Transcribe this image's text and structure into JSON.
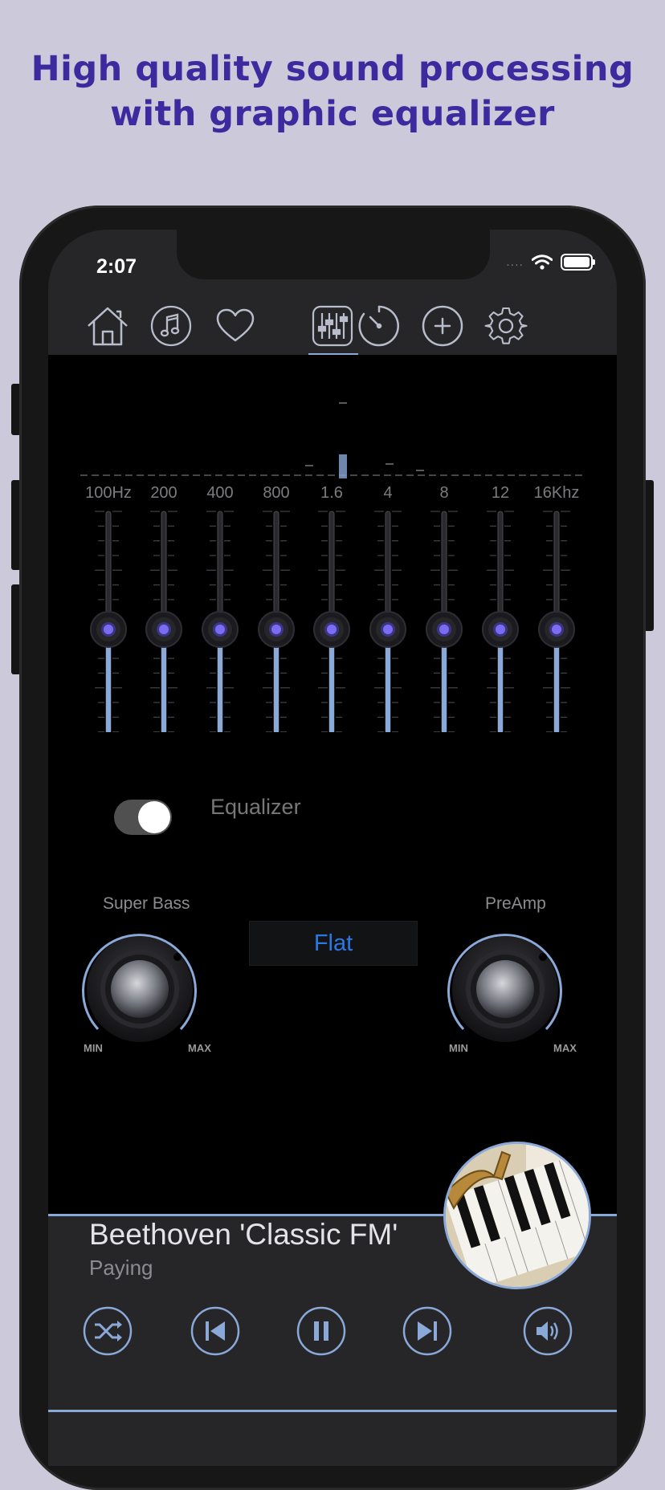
{
  "headline": {
    "line1": "High quality sound processing",
    "line2": "with graphic equalizer"
  },
  "status_bar": {
    "time": "2:07",
    "signal": "....",
    "wifi_icon": "wifi-icon",
    "battery_icon": "battery-icon"
  },
  "nav": [
    {
      "name": "home",
      "icon": "home-icon"
    },
    {
      "name": "music",
      "icon": "music-note-icon"
    },
    {
      "name": "favorites",
      "icon": "heart-icon"
    },
    {
      "name": "equalizer",
      "icon": "sliders-icon",
      "active": true
    },
    {
      "name": "timer",
      "icon": "timer-icon"
    },
    {
      "name": "add",
      "icon": "plus-icon"
    },
    {
      "name": "settings",
      "icon": "gear-icon"
    }
  ],
  "equalizer": {
    "bands": [
      "100Hz",
      "200",
      "400",
      "800",
      "1.6",
      "4",
      "8",
      "12",
      "16Khz"
    ],
    "levels": [
      0,
      0,
      0,
      0,
      0,
      0,
      0,
      0,
      0
    ],
    "enabled": true,
    "toggle_label": "Equalizer",
    "preset": "Flat"
  },
  "knobs": {
    "bass_label": "Super Bass",
    "preamp_label": "PreAmp",
    "min_label": "MIN",
    "max_label": "MAX"
  },
  "player": {
    "title": "Beethoven 'Classic FM'",
    "status": "Paying",
    "controls": [
      "shuffle-icon",
      "previous-icon",
      "pause-icon",
      "next-icon",
      "volume-icon"
    ]
  },
  "colors": {
    "accent": "#8aa8d8",
    "headline": "#3d2a9e",
    "preset_text": "#2a78e4",
    "slider_thumb_glow": "#7b6cf2"
  }
}
